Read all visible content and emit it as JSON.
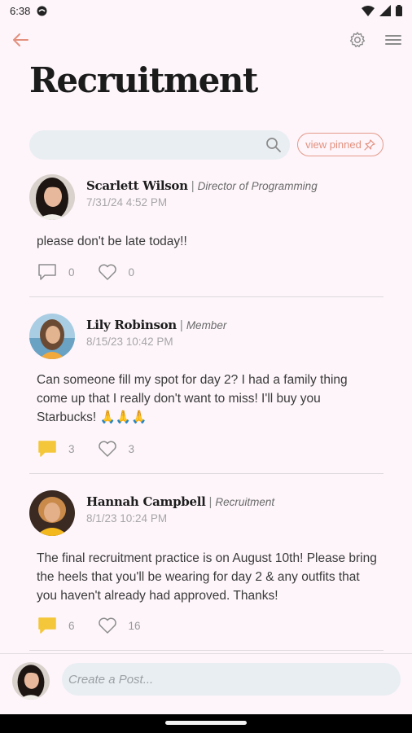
{
  "status": {
    "time": "6:38"
  },
  "header": {
    "title": "Recruitment"
  },
  "search": {
    "placeholder": "",
    "view_pinned_label": "view pinned"
  },
  "posts": [
    {
      "author": "Scarlett Wilson",
      "role": "Director of Programming",
      "timestamp": "7/31/24 4:52 PM",
      "body": "please don't be late today!!",
      "comments": "0",
      "likes": "0",
      "has_comments": false
    },
    {
      "author": "Lily Robinson",
      "role": "Member",
      "timestamp": "8/15/23 10:42 PM",
      "body": "Can someone fill my spot for day 2? I had a family thing come up that I really don't want to miss! I'll buy you Starbucks! 🙏🙏🙏",
      "comments": "3",
      "likes": "3",
      "has_comments": true
    },
    {
      "author": "Hannah Campbell",
      "role": "Recruitment",
      "timestamp": "8/1/23 10:24 PM",
      "body": "The final recruitment practice is on August 10th! Please bring the heels that you'll be wearing for day 2 & any outfits that you haven't already had approved. Thanks!",
      "comments": "6",
      "likes": "16",
      "has_comments": true
    }
  ],
  "composer": {
    "placeholder": "Create a Post..."
  },
  "colors": {
    "accent": "#e3907e",
    "comment_active": "#f4c63a",
    "background": "#fdf5fa"
  },
  "icons": [
    "back-arrow-icon",
    "gear-icon",
    "menu-icon",
    "search-icon",
    "pin-icon",
    "comment-icon",
    "heart-icon"
  ]
}
